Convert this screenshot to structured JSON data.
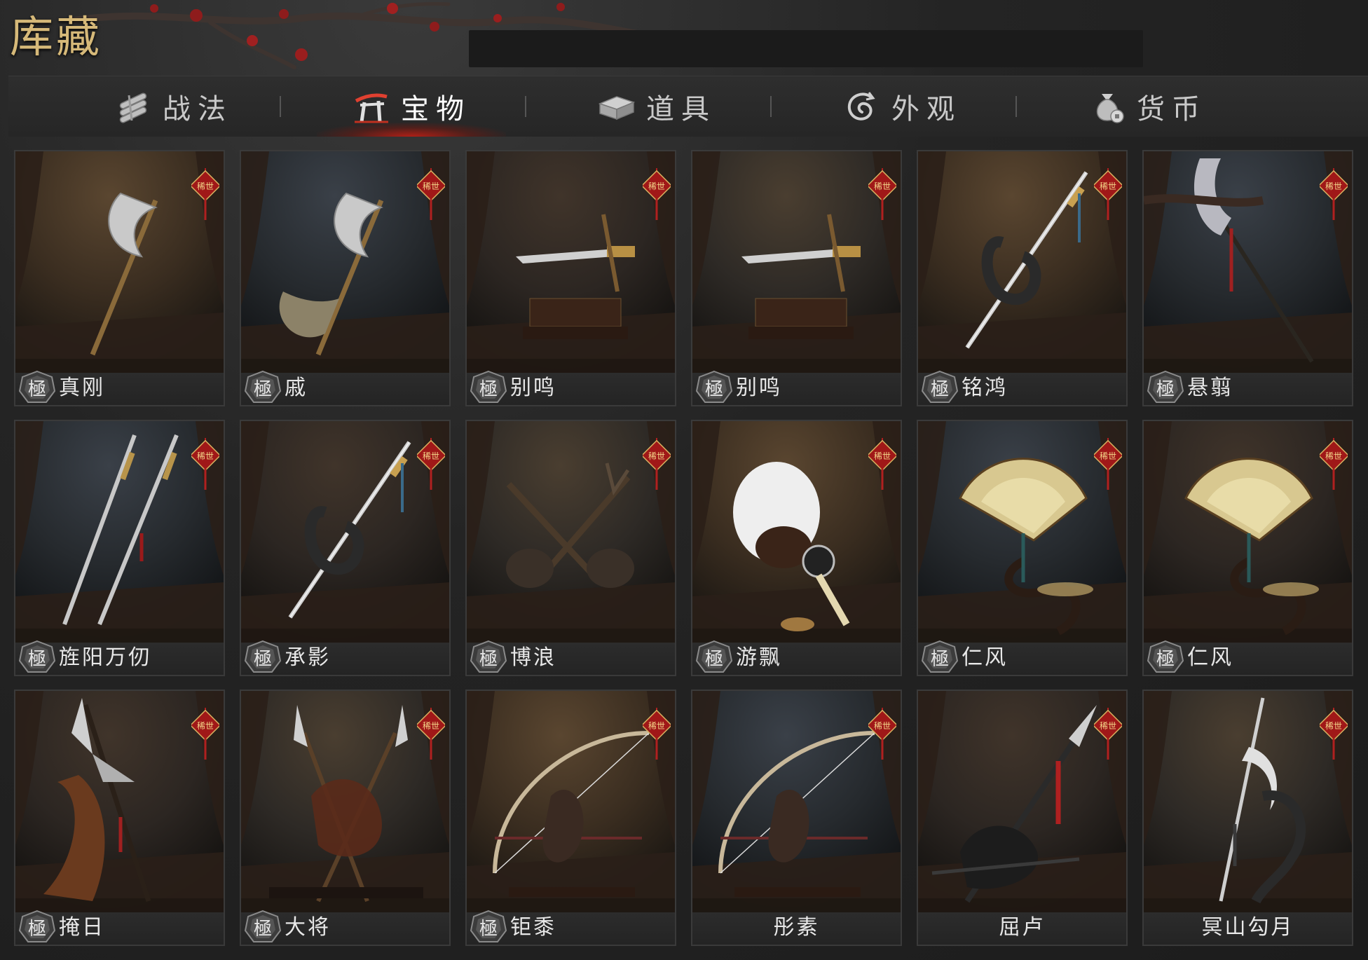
{
  "page": {
    "title": "库藏",
    "accent": "#d6b979",
    "active_glow": "#c81e14"
  },
  "tabs": [
    {
      "label": "战法",
      "icon": "scroll-bundle-icon",
      "active": false
    },
    {
      "label": "宝物",
      "icon": "torii-gate-icon",
      "active": true
    },
    {
      "label": "道具",
      "icon": "chest-icon",
      "active": false
    },
    {
      "label": "外观",
      "icon": "swirl-icon",
      "active": false
    },
    {
      "label": "货币",
      "icon": "money-bag-icon",
      "active": false
    }
  ],
  "rarity_tag_text": "稀世",
  "tier_badge_text": "極",
  "items": [
    {
      "name": "真刚",
      "weapon": "axe",
      "tier": true,
      "rare": true
    },
    {
      "name": "戚",
      "weapon": "battle-axe",
      "tier": true,
      "rare": true
    },
    {
      "name": "别鸣",
      "weapon": "dagger",
      "tier": true,
      "rare": true
    },
    {
      "name": "别鸣",
      "weapon": "dagger",
      "tier": true,
      "rare": true
    },
    {
      "name": "铭鸿",
      "weapon": "sword",
      "tier": true,
      "rare": true
    },
    {
      "name": "悬翦",
      "weapon": "glaive",
      "tier": true,
      "rare": true
    },
    {
      "name": "旌阳万仞",
      "weapon": "twin-swords",
      "tier": true,
      "rare": true
    },
    {
      "name": "承影",
      "weapon": "sword",
      "tier": true,
      "rare": true
    },
    {
      "name": "博浪",
      "weapon": "maces",
      "tier": true,
      "rare": true
    },
    {
      "name": "游飘",
      "weapon": "feather-fan",
      "tier": true,
      "rare": true
    },
    {
      "name": "仁风",
      "weapon": "folding-fan",
      "tier": true,
      "rare": true
    },
    {
      "name": "仁风",
      "weapon": "folding-fan",
      "tier": true,
      "rare": true
    },
    {
      "name": "掩日",
      "weapon": "halberd",
      "tier": true,
      "rare": true
    },
    {
      "name": "大将",
      "weapon": "twin-spears",
      "tier": true,
      "rare": true
    },
    {
      "name": "钜黍",
      "weapon": "bow",
      "tier": true,
      "rare": true
    },
    {
      "name": "彤素",
      "weapon": "bow",
      "tier": false,
      "rare": true
    },
    {
      "name": "屈卢",
      "weapon": "spear",
      "tier": false,
      "rare": true
    },
    {
      "name": "冥山勾月",
      "weapon": "crescent-spear",
      "tier": false,
      "rare": true
    }
  ]
}
